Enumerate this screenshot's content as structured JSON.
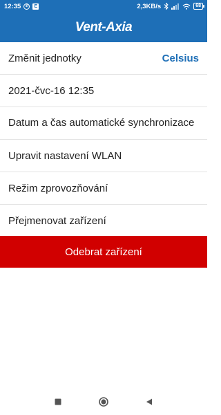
{
  "status_bar": {
    "time": "12:35",
    "speed": "2,3KB/s",
    "battery": "68",
    "icons": [
      "whatsapp-icon",
      "notification-e-icon",
      "bluetooth-icon",
      "signal-icon",
      "wifi-icon",
      "battery-icon"
    ]
  },
  "header": {
    "logo_text": "Vent-Axia"
  },
  "settings": {
    "units_label": "Změnit jednotky",
    "units_value": "Celsius",
    "datetime": "2021-čvc-16 12:35",
    "auto_sync_label": "Datum a čas automatické synchronizace",
    "wlan_label": "Upravit nastavení WLAN",
    "commissioning_label": "Režim zprovozňování",
    "rename_label": "Přejmenovat zařízení"
  },
  "actions": {
    "remove_label": "Odebrat zařízení"
  },
  "colors": {
    "brand": "#1e6fb7",
    "danger": "#d10000"
  },
  "nav": {
    "icons": [
      "recents-square-icon",
      "home-circle-icon",
      "back-triangle-icon"
    ]
  }
}
